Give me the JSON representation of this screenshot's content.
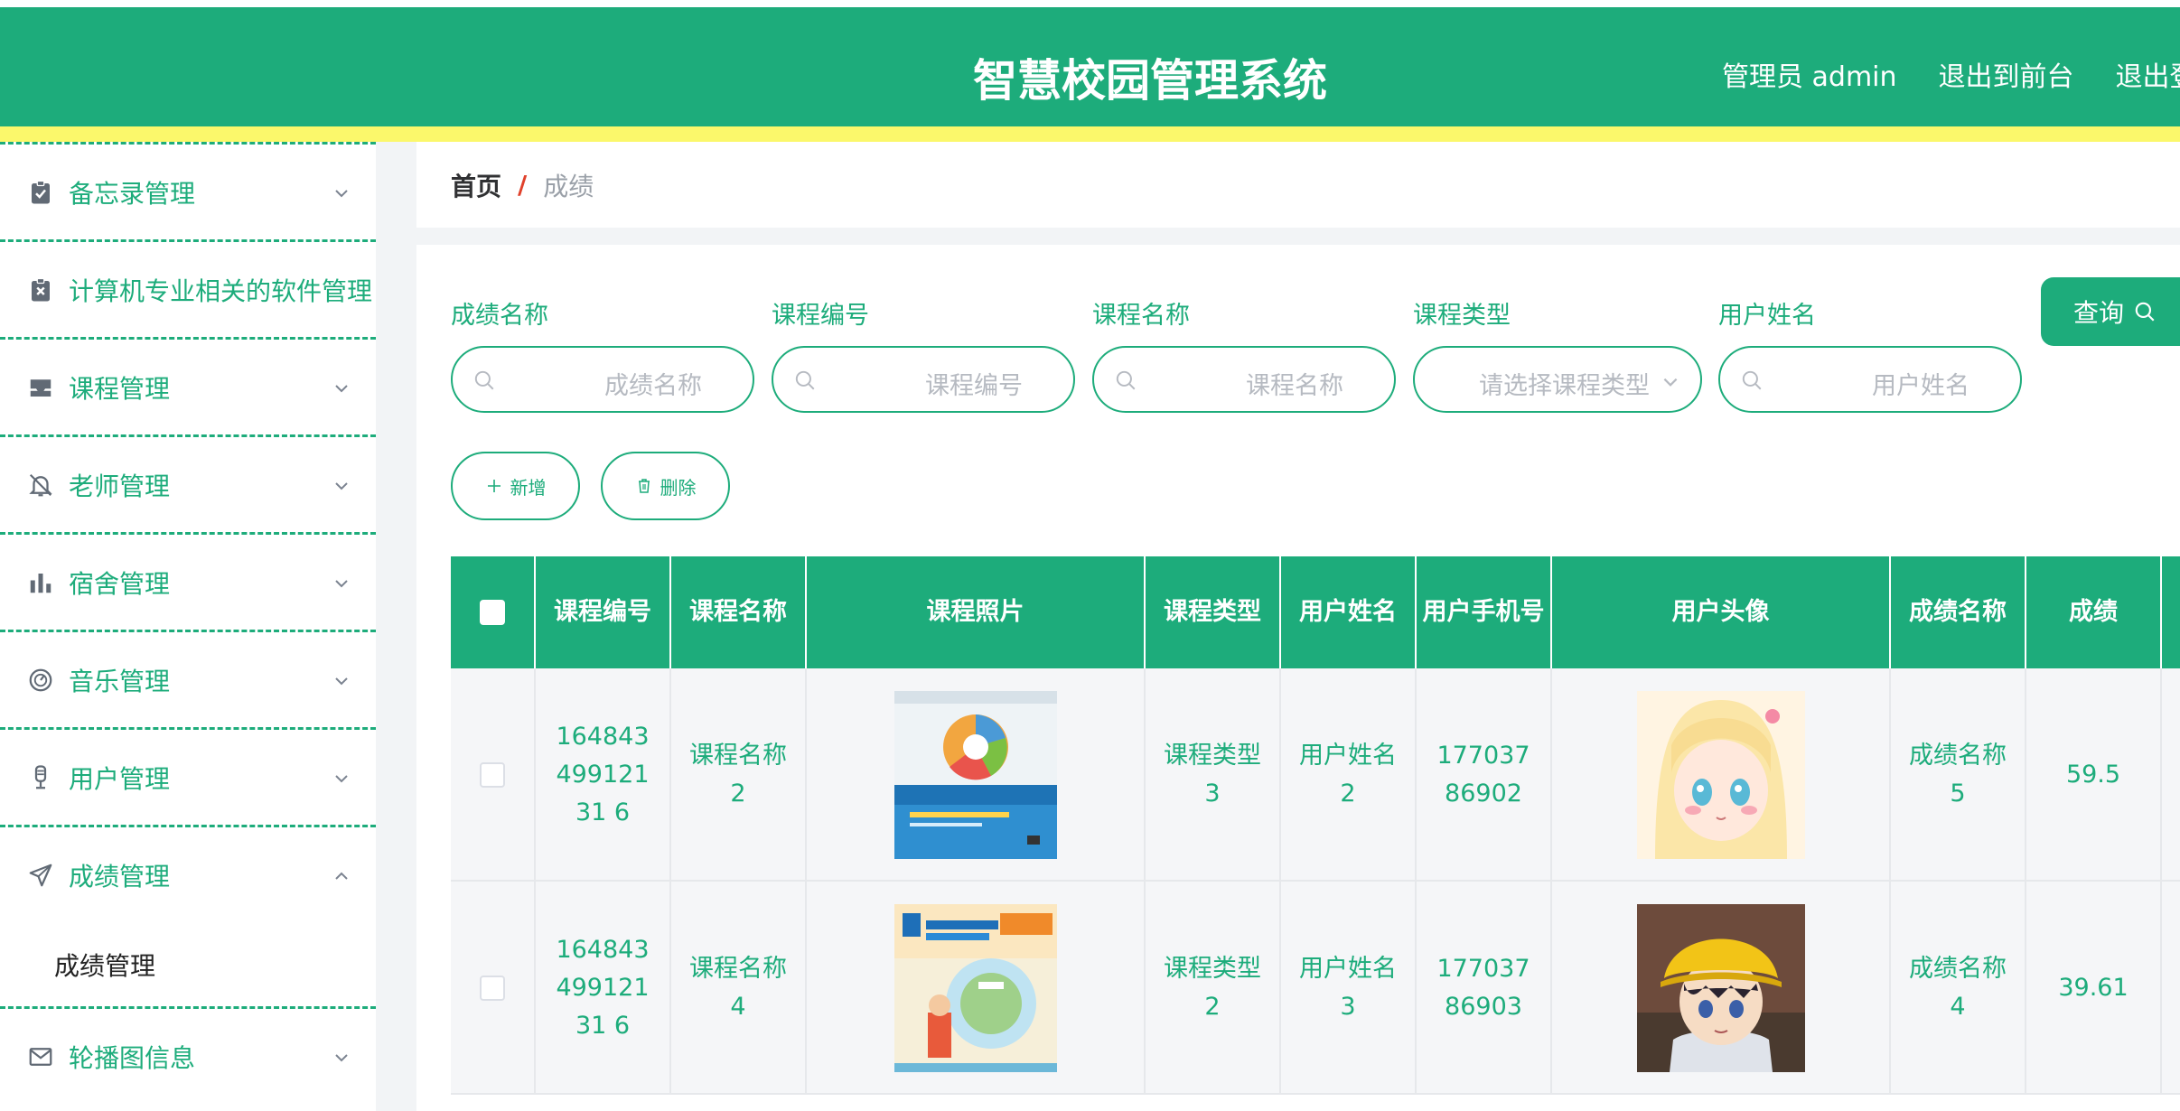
{
  "header": {
    "title": "智慧校园管理系统",
    "nav": [
      "管理员 admin",
      "退出到前台",
      "退出登录"
    ]
  },
  "sidebar": {
    "items": [
      {
        "label": "备忘录管理",
        "icon": "clipboard-check-icon",
        "expanded": false
      },
      {
        "label": "计算机专业相关的软件管理",
        "icon": "clipboard-x-icon",
        "expanded": false
      },
      {
        "label": "课程管理",
        "icon": "inbox-icon",
        "expanded": false
      },
      {
        "label": "老师管理",
        "icon": "bell-off-icon",
        "expanded": false
      },
      {
        "label": "宿舍管理",
        "icon": "bar-chart-icon",
        "expanded": false
      },
      {
        "label": "音乐管理",
        "icon": "gauge-icon",
        "expanded": false
      },
      {
        "label": "用户管理",
        "icon": "microphone-icon",
        "expanded": false
      },
      {
        "label": "成绩管理",
        "icon": "send-icon",
        "expanded": true,
        "submenu": [
          "成绩管理"
        ]
      },
      {
        "label": "轮播图信息",
        "icon": "mail-icon",
        "expanded": false
      }
    ]
  },
  "breadcrumb": {
    "home": "首页",
    "separator": "/",
    "current": "成绩"
  },
  "filters": [
    {
      "label": "成绩名称",
      "placeholder": "成绩名称",
      "type": "search"
    },
    {
      "label": "课程编号",
      "placeholder": "课程编号",
      "type": "search"
    },
    {
      "label": "课程名称",
      "placeholder": "课程名称",
      "type": "search"
    },
    {
      "label": "课程类型",
      "placeholder": "请选择课程类型",
      "type": "select"
    },
    {
      "label": "用户姓名",
      "placeholder": "用户姓名",
      "type": "search"
    }
  ],
  "query_button": "查询",
  "actions": {
    "add": "新增",
    "delete": "删除"
  },
  "table": {
    "columns": [
      "课程编号",
      "课程名称",
      "课程照片",
      "课程类型",
      "用户姓名",
      "用户手机号",
      "用户头像",
      "成绩名称",
      "成绩"
    ],
    "rows": [
      {
        "course_no": "16484349912131 6",
        "course_name": "课程名称2",
        "course_photo": "book-java-cover",
        "course_type": "课程类型3",
        "user_name": "用户姓名2",
        "user_phone": "17703786902",
        "avatar": "anime-girl-blonde",
        "score_name": "成绩名称5",
        "score": "59.5"
      },
      {
        "course_no": "16484349912131 6",
        "course_name": "课程名称4",
        "course_photo": "book-math-cover",
        "course_type": "课程类型2",
        "user_name": "用户姓名3",
        "user_phone": "17703786903",
        "avatar": "anime-boy-yellow-hat",
        "score_name": "成绩名称4",
        "score": "39.61"
      }
    ]
  },
  "colors": {
    "primary": "#1dac7b",
    "stripe": "#fbf86b",
    "danger": "#e0412b"
  }
}
